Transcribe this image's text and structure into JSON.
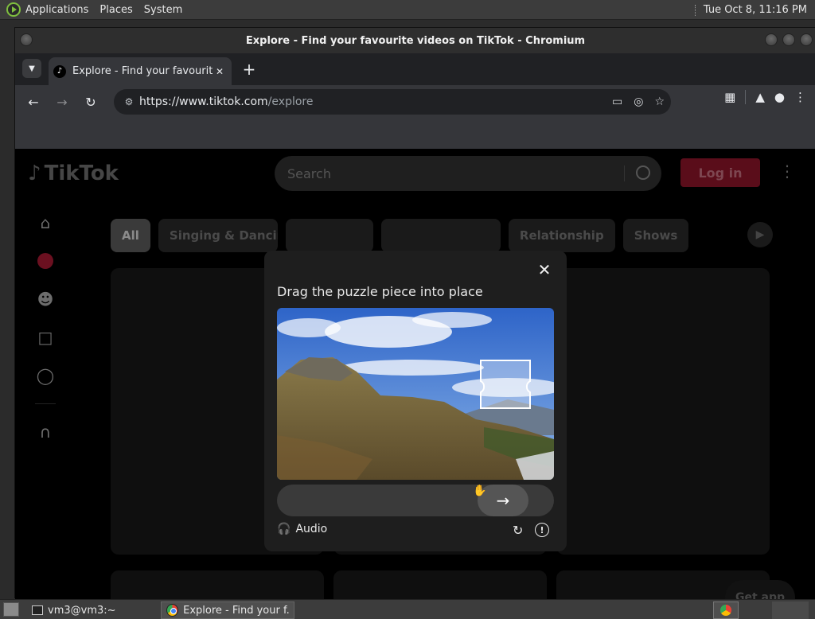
{
  "top_panel": {
    "menus": [
      "Applications",
      "Places",
      "System"
    ],
    "clock": "Tue Oct  8, 11:16 PM"
  },
  "window": {
    "title": "Explore - Find your favourite videos on TikTok - Chromium"
  },
  "browser": {
    "tab_title": "Explore - Find your favourite",
    "url_host": "https://www.tiktok.com",
    "url_path": "/explore"
  },
  "tiktok": {
    "logo": "TikTok",
    "search_placeholder": "Search",
    "login_label": "Log in",
    "categories": [
      "All",
      "Singing & Dancing",
      "",
      "",
      "",
      "Relationship",
      "Shows"
    ],
    "get_app": "Get app"
  },
  "captcha": {
    "heading": "Drag the puzzle piece into place",
    "audio_label": "Audio",
    "slider_progress": 0.8
  },
  "taskbar": {
    "terminal_label": "vm3@vm3:~",
    "browser_label": "Explore - Find your f..."
  }
}
